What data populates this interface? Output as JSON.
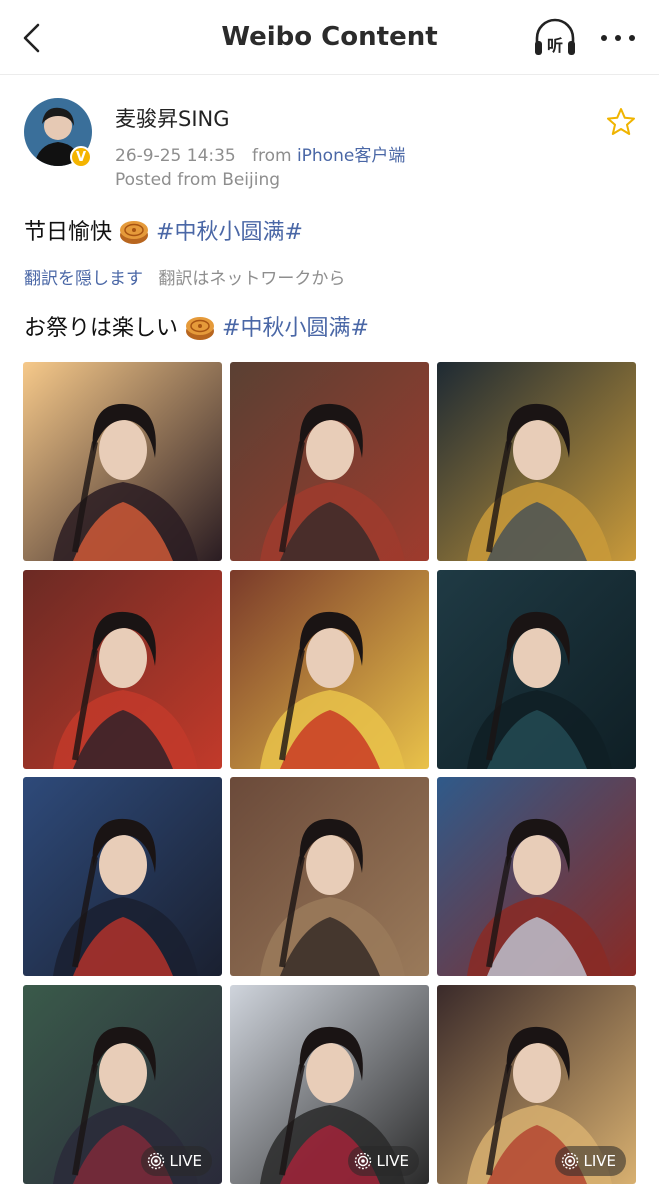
{
  "header": {
    "title": "Weibo Content",
    "listen_label": "听"
  },
  "post": {
    "username": "麦骏昇SING",
    "timestamp": "26-9-25 14:35",
    "from_word": "from",
    "source": "iPhone客户端",
    "location": "Posted from Beijing",
    "verified_badge": "V",
    "text_plain": "节日愉快",
    "hashtag": "#中秋小圆满#",
    "translate_hide": "翻訳を隠します",
    "translate_note": "翻訳はネットワークから",
    "translated_plain": "お祭りは楽しい",
    "translated_hashtag": "#中秋小圆满#"
  },
  "gallery": {
    "live_label": "LIVE",
    "photos": [
      {
        "palette": [
          "#f6c98a",
          "#e2603a",
          "#2a1c22"
        ],
        "live": false
      },
      {
        "palette": [
          "#5a4033",
          "#2d2a2a",
          "#9f3b2d"
        ],
        "live": false
      },
      {
        "palette": [
          "#1e2a33",
          "#3a4a5a",
          "#c99a3a"
        ],
        "live": false
      },
      {
        "palette": [
          "#6b2a24",
          "#1f1f2a",
          "#c23a2a"
        ],
        "live": false
      },
      {
        "palette": [
          "#7a3a2a",
          "#c62a20",
          "#e9c24a"
        ],
        "live": false
      },
      {
        "palette": [
          "#1f3a44",
          "#26505a",
          "#0f1f25"
        ],
        "live": false
      },
      {
        "palette": [
          "#2e4a7a",
          "#c6342a",
          "#1a2030"
        ],
        "live": false
      },
      {
        "palette": [
          "#6b4a3a",
          "#2a2220",
          "#9a7a5a"
        ],
        "live": false
      },
      {
        "palette": [
          "#2f5a8a",
          "#c4d4e4",
          "#8a2a24"
        ],
        "live": false
      },
      {
        "palette": [
          "#3a5a4a",
          "#8a2a3a",
          "#2a2a3a"
        ],
        "live": true
      },
      {
        "palette": [
          "#cfd4dc",
          "#b0223a",
          "#2a2a2a"
        ],
        "live": true
      },
      {
        "palette": [
          "#3a2a2a",
          "#b03a2a",
          "#d8b070"
        ],
        "live": true
      }
    ]
  },
  "colors": {
    "link_blue": "#4a67a6",
    "secondary_gray": "#8e8e8e",
    "star_gold": "#f0b400"
  }
}
